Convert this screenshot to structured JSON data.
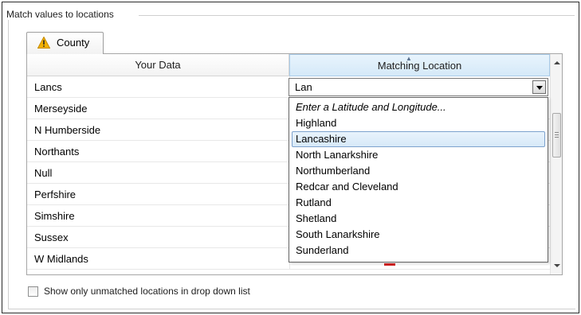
{
  "group": {
    "title": "Match values to locations"
  },
  "tab": {
    "label": "County",
    "icon": "warning-icon",
    "icon_color": "#f2b100"
  },
  "grid": {
    "columns": [
      "Your Data",
      "Matching Location"
    ],
    "rows": [
      "Lancs",
      "Merseyside",
      "N Humberside",
      "Northants",
      "Null",
      "Perfshire",
      "Simshire",
      "Sussex",
      "W Midlands"
    ]
  },
  "combo": {
    "value": "Lan"
  },
  "dropdown": {
    "options": [
      "Enter a Latitude and Longitude...",
      "Highland",
      "Lancashire",
      "North Lanarkshire",
      "Northumberland",
      "Redcar and Cleveland",
      "Rutland",
      "Shetland",
      "South Lanarkshire",
      "Sunderland"
    ],
    "selected": "Lancashire"
  },
  "checkbox": {
    "label": "Show only unmatched locations in drop down list",
    "checked": false
  },
  "colors": {
    "header_highlight": "#d5e9f8",
    "selection_border": "#7da2ce",
    "warning": "#f2b100"
  }
}
